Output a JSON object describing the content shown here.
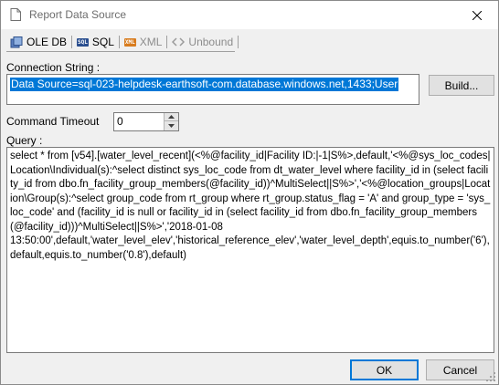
{
  "window": {
    "title": "Report Data Source"
  },
  "tabs": [
    {
      "label": "OLE DB",
      "icon": "database-icon",
      "disabled": false
    },
    {
      "label": "SQL",
      "icon": "sql-icon",
      "disabled": false
    },
    {
      "label": "XML",
      "icon": "xml-icon",
      "disabled": true
    },
    {
      "label": "Unbound",
      "icon": "unbound-icon",
      "disabled": true
    }
  ],
  "tab_icons": {
    "sql_text": "SQL",
    "xml_text": "XML"
  },
  "connection": {
    "label": "Connection String :",
    "value": "Data Source=sql-023-helpdesk-earthsoft-com.database.windows.net,1433;User",
    "build_label": "Build..."
  },
  "timeout": {
    "label": "Command Timeout",
    "value": "0"
  },
  "query": {
    "label": "Query :",
    "value": "select * from [v54].[water_level_recent](<%@facility_id|Facility ID:|-1|S%>,default,'<%@sys_loc_codes|Location\\Individual(s):^select distinct sys_loc_code from dt_water_level where facility_id in (select facility_id from dbo.fn_facility_group_members(@facility_id))^MultiSelect||S%>','<%@location_groups|Location\\Group(s):^select group_code from rt_group where rt_group.status_flag = 'A' and group_type = 'sys_loc_code' and (facility_id is null or facility_id in (select facility_id from dbo.fn_facility_group_members(@facility_id)))^MultiSelect||S%>','2018-01-08\n13:50:00',default,'water_level_elev','historical_reference_elev','water_level_depth',equis.to_number('6'),default,equis.to_number('0.8'),default)"
  },
  "footer": {
    "ok_label": "OK",
    "cancel_label": "Cancel"
  },
  "colors": {
    "selection": "#0078d7",
    "default_button_border": "#0078d7"
  }
}
